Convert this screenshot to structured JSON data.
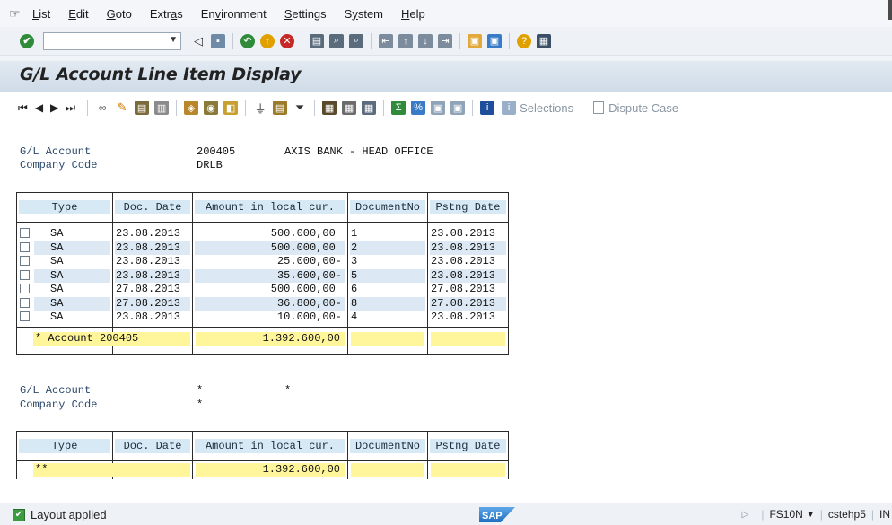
{
  "menu": {
    "items": [
      {
        "pre": "",
        "u": "L",
        "post": "ist"
      },
      {
        "pre": "",
        "u": "E",
        "post": "dit"
      },
      {
        "pre": "",
        "u": "G",
        "post": "oto"
      },
      {
        "pre": "Extr",
        "u": "a",
        "post": "s"
      },
      {
        "pre": "En",
        "u": "v",
        "post": "ironment"
      },
      {
        "pre": "",
        "u": "S",
        "post": "ettings"
      },
      {
        "pre": "S",
        "u": "y",
        "post": "stem"
      },
      {
        "pre": "",
        "u": "H",
        "post": "elp"
      }
    ]
  },
  "title": "G/L Account Line Item Display",
  "appbar": {
    "selections_label": "Selections",
    "dispute_label": "Dispute Case"
  },
  "header1": {
    "gl_label": "G/L Account",
    "gl_value": "200405",
    "gl_desc": "AXIS BANK - HEAD OFFICE",
    "cc_label": "Company Code",
    "cc_value": "DRLB"
  },
  "table1": {
    "columns": [
      "Type",
      "Doc. Date",
      "Amount in local cur.",
      "DocumentNo",
      "Pstng Date"
    ],
    "rows": [
      {
        "type": "SA",
        "doc_date": "23.08.2013",
        "amount": "500.000,00 ",
        "docno": "1",
        "pstng": "23.08.2013"
      },
      {
        "type": "SA",
        "doc_date": "23.08.2013",
        "amount": "500.000,00 ",
        "docno": "2",
        "pstng": "23.08.2013"
      },
      {
        "type": "SA",
        "doc_date": "23.08.2013",
        "amount": "25.000,00-",
        "docno": "3",
        "pstng": "23.08.2013"
      },
      {
        "type": "SA",
        "doc_date": "23.08.2013",
        "amount": "35.600,00-",
        "docno": "5",
        "pstng": "23.08.2013"
      },
      {
        "type": "SA",
        "doc_date": "27.08.2013",
        "amount": "500.000,00 ",
        "docno": "6",
        "pstng": "27.08.2013"
      },
      {
        "type": "SA",
        "doc_date": "27.08.2013",
        "amount": "36.800,00-",
        "docno": "8",
        "pstng": "27.08.2013"
      },
      {
        "type": "SA",
        "doc_date": "23.08.2013",
        "amount": "10.000,00-",
        "docno": "4",
        "pstng": "23.08.2013"
      }
    ],
    "total_label": "* Account 200405",
    "total_amount": "1.392.600,00"
  },
  "header2": {
    "gl_label": "G/L Account",
    "gl_value": "*",
    "gl_desc": "*",
    "cc_label": "Company Code",
    "cc_value": "*"
  },
  "table2": {
    "columns": [
      "Type",
      "Doc. Date",
      "Amount in local cur.",
      "DocumentNo",
      "Pstng Date"
    ],
    "total_label": "**",
    "total_amount": "1.392.600,00"
  },
  "status": {
    "message": "Layout applied",
    "transaction": "FS10N",
    "server": "cstehp5",
    "client": "IN"
  },
  "colors": {
    "header_bg": "#d8e9f6",
    "alt_row": "#dce8f3",
    "total_bg": "#fff59a",
    "status_ok": "#3c9a3f"
  }
}
